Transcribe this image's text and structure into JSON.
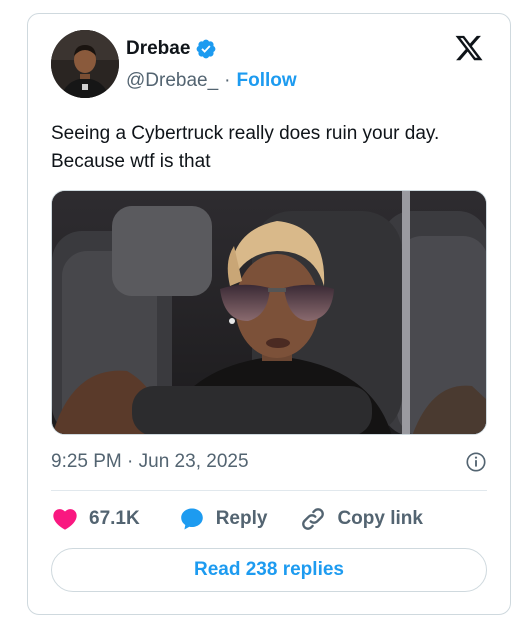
{
  "author": {
    "name": "Drebae",
    "handle": "@Drebae_",
    "separator": "·",
    "follow_label": "Follow",
    "verified_color": "#1d9bf0"
  },
  "tweet": {
    "text": "Seeing a Cybertruck really does ruin your day. Because wtf is that",
    "timestamp": "9:25 PM · Jun 23, 2025"
  },
  "actions": {
    "likes": "67.1K",
    "reply_label": "Reply",
    "copy_link_label": "Copy link"
  },
  "read_replies_label": "Read 238 replies",
  "icons": {
    "logo": "x-logo-icon",
    "verified": "verified-badge-icon",
    "info": "info-icon",
    "heart": "heart-icon",
    "reply": "speech-bubble-icon",
    "link": "link-icon"
  },
  "colors": {
    "accent": "#1d9bf0",
    "like": "#f91880",
    "text": "#0f1419",
    "muted": "#536471"
  }
}
